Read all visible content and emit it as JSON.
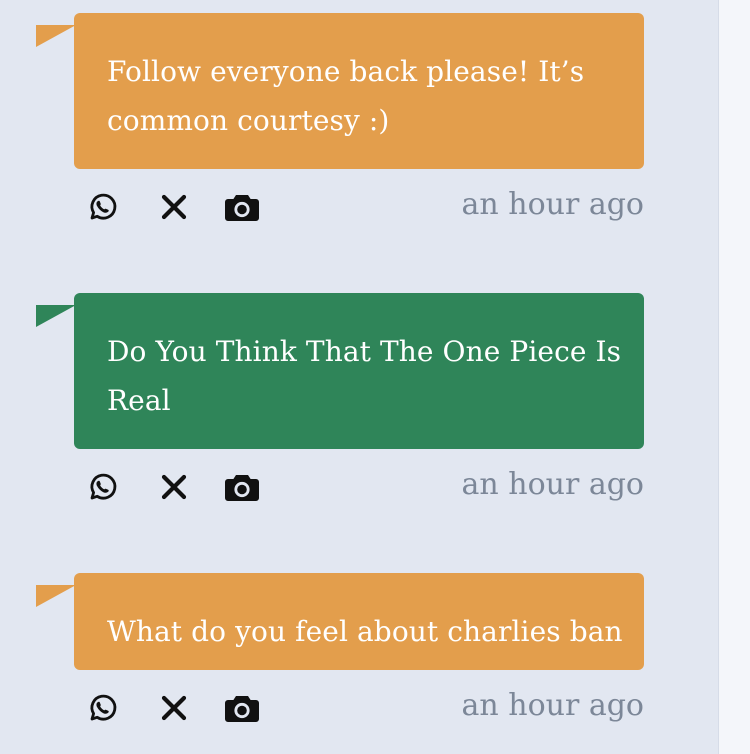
{
  "posts": [
    {
      "message": "Follow everyone back please! It’s common courtesy :)",
      "color": "#e39e4c",
      "time": "an hour ago"
    },
    {
      "message": "Do You Think That The One Piece Is Real",
      "color": "#2f8559",
      "time": "an hour ago"
    },
    {
      "message": "What do you feel about charlies ban",
      "color": "#e39e4c",
      "time": "an hour ago"
    }
  ],
  "icons": {
    "share_whatsapp": "whatsapp-icon",
    "share_x": "x-icon",
    "share_snapshot": "camera-icon"
  },
  "colors": {
    "background": "#e2e7f1",
    "muted_text": "#7c8798",
    "icon": "#111111"
  }
}
